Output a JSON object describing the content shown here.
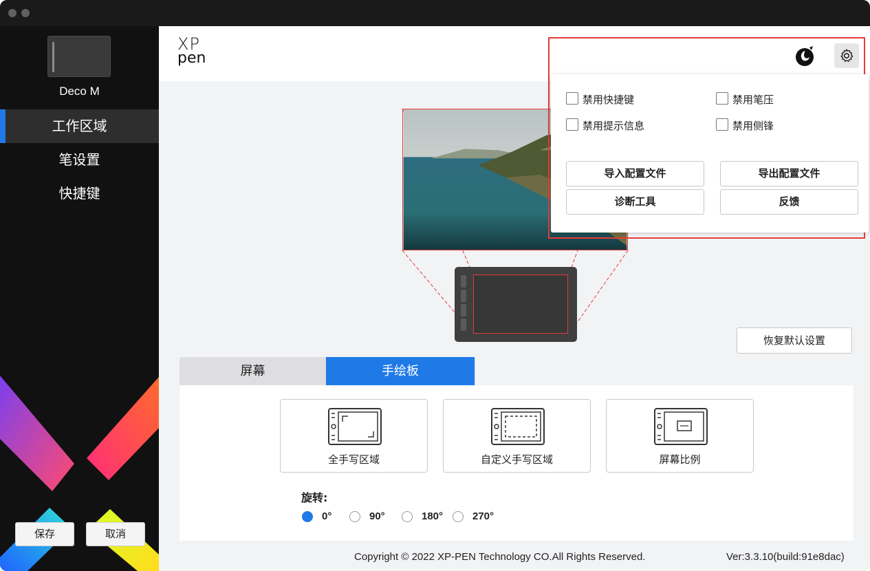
{
  "window": {
    "sidebar": {
      "device_name": "Deco M",
      "nav": [
        {
          "label": "工作区域",
          "active": true
        },
        {
          "label": "笔设置",
          "active": false
        },
        {
          "label": "快捷键",
          "active": false
        }
      ],
      "save_label": "保存",
      "cancel_label": "取消"
    },
    "header": {
      "logo_line1": "XP",
      "logo_line2": "pen"
    },
    "settings_menu": {
      "checkboxes": [
        {
          "label": "禁用快捷键",
          "checked": false
        },
        {
          "label": "禁用笔压",
          "checked": false
        },
        {
          "label": "禁用提示信息",
          "checked": false
        },
        {
          "label": "禁用侧锋",
          "checked": false
        }
      ],
      "buttons": [
        "导入配置文件",
        "导出配置文件",
        "诊断工具",
        "反馈"
      ]
    },
    "reset_label": "恢复默认设置",
    "tabs": [
      {
        "label": "屏幕",
        "active": false
      },
      {
        "label": "手绘板",
        "active": true
      }
    ],
    "modes": [
      {
        "label": "全手写区域",
        "icon": "full-area-icon"
      },
      {
        "label": "自定义手写区域",
        "icon": "custom-area-icon"
      },
      {
        "label": "屏幕比例",
        "icon": "screen-ratio-icon"
      }
    ],
    "rotation": {
      "label": "旋转:",
      "options": [
        "0°",
        "90°",
        "180°",
        "270°"
      ],
      "selected": "0°"
    },
    "footer": {
      "copyright": "Copyright © 2022  XP-PEN Technology CO.All Rights Reserved.",
      "version": "Ver:3.3.10(build:91e8dac)"
    },
    "colors": {
      "accent": "#1f7ae8",
      "highlight": "#e53b3b",
      "sidebar_bg": "#111111"
    }
  }
}
